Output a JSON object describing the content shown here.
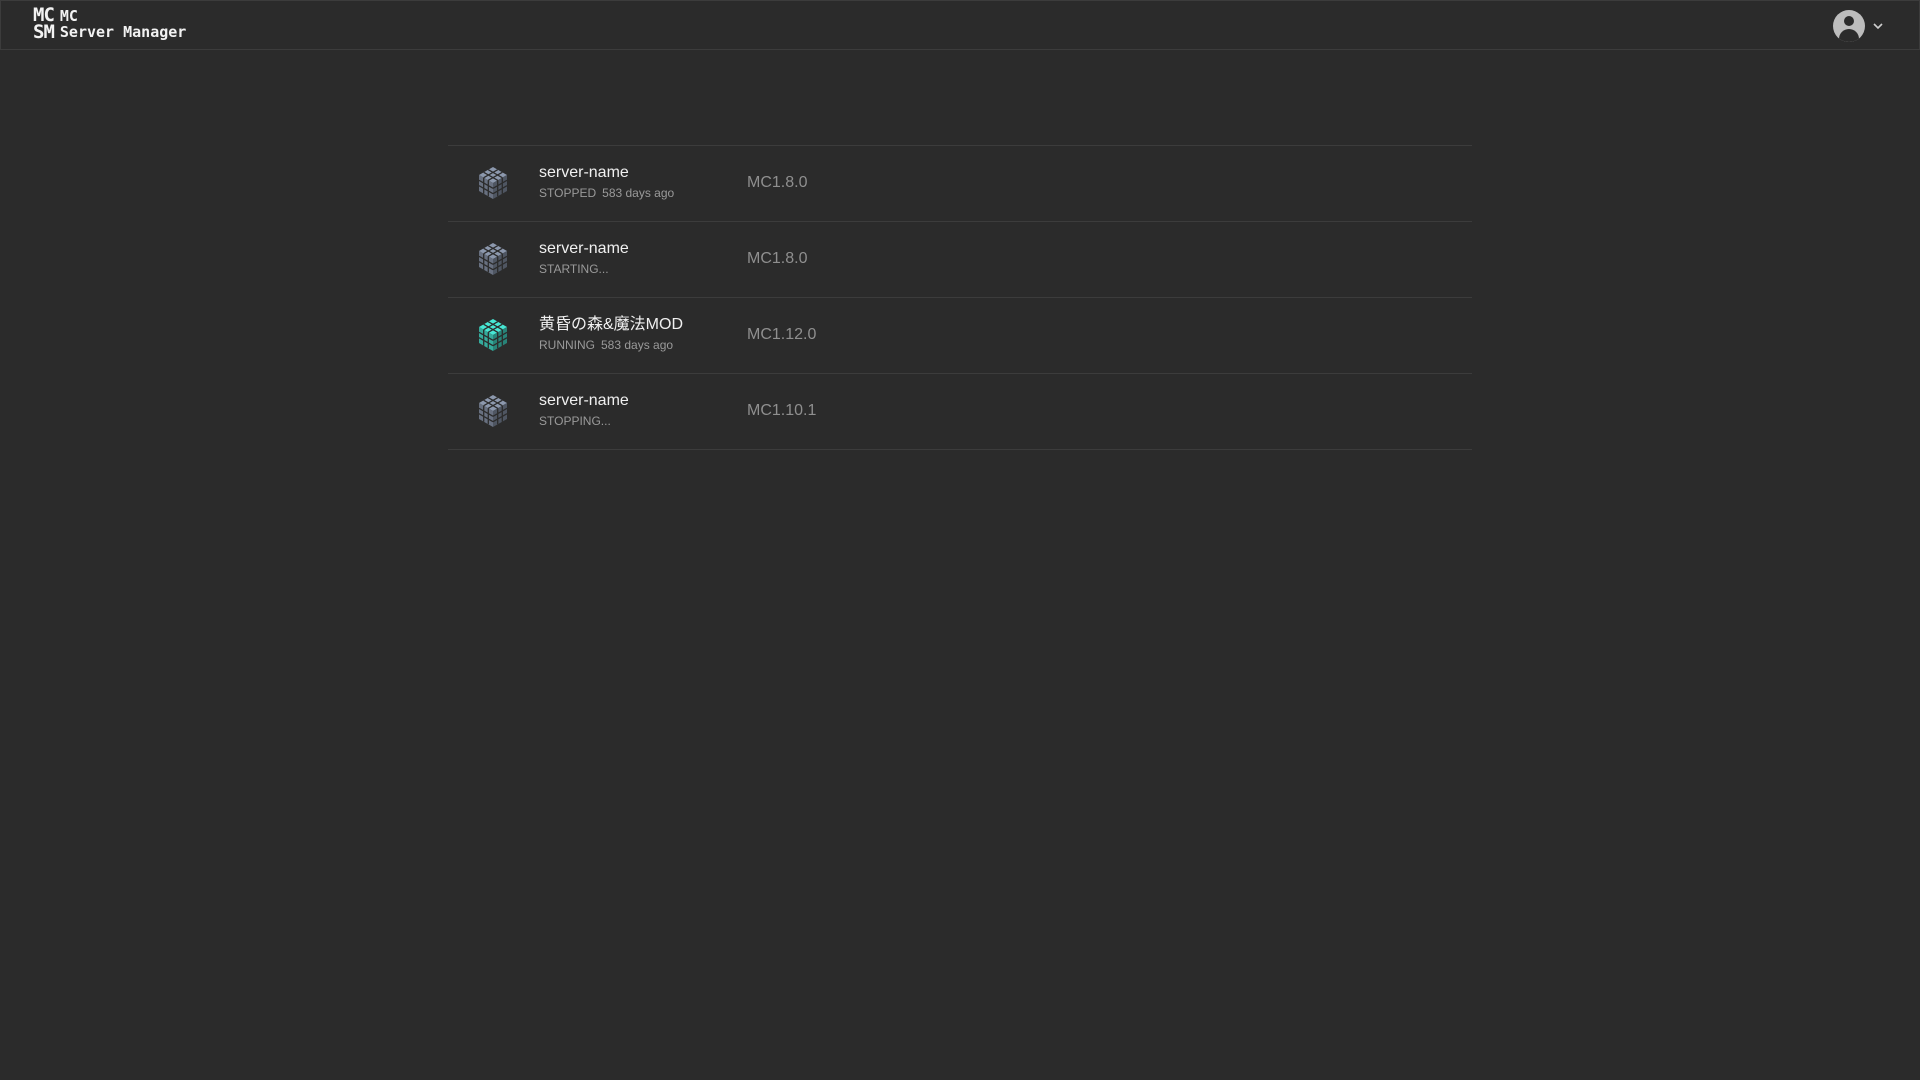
{
  "app": {
    "logo_mark_line1": "MC",
    "logo_mark_line2": "SM",
    "logo_text_line1": "MC",
    "logo_text_line2": "Server Manager"
  },
  "account": {
    "avatar_icon": "user-avatar-icon",
    "menu_icon": "chevron-down-icon"
  },
  "servers": [
    {
      "name": "server-name",
      "status": "STOPPED",
      "time": "583 days ago",
      "version": "MC1.8.0",
      "icon_color": "#7a8496"
    },
    {
      "name": "server-name",
      "status": "STARTING...",
      "time": "",
      "version": "MC1.8.0",
      "icon_color": "#7a8496"
    },
    {
      "name": "黄昏の森&魔法MOD",
      "status": "RUNNING",
      "time": "583 days ago",
      "version": "MC1.12.0",
      "icon_color": "#3ec9b8"
    },
    {
      "name": "server-name",
      "status": "STOPPING...",
      "time": "",
      "version": "MC1.10.1",
      "icon_color": "#7a8496"
    }
  ]
}
